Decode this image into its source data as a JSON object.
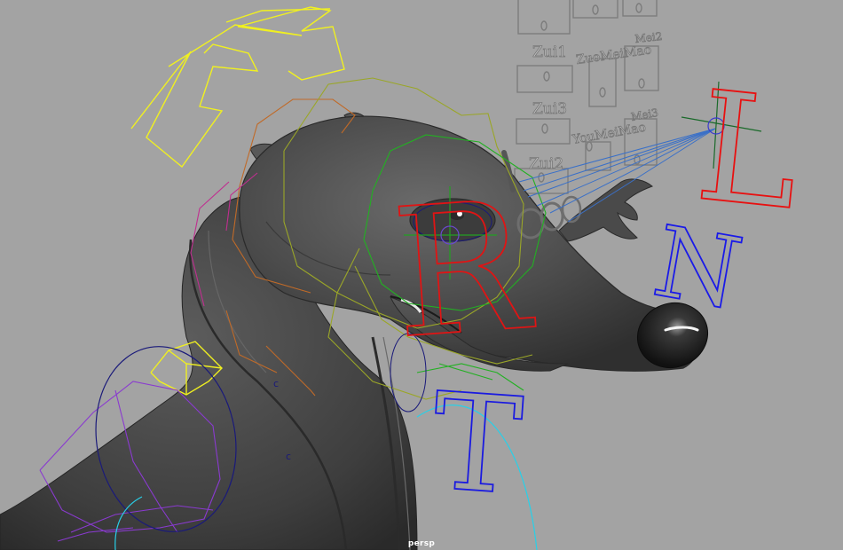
{
  "viewport": {
    "camera_label": "persp",
    "background": "#a3a3a3"
  },
  "face_controls": {
    "labels": {
      "zui1": "Zui1",
      "zuo_mei_mao": "ZuoMeiMao",
      "mei2": "Mei2",
      "zui3": "Zui3",
      "you_mei_mao": "YouMeiMao",
      "mei3": "Mei3",
      "zui2": "Zui2"
    },
    "color": "#7c7c7c"
  },
  "rig_controls": {
    "letters": {
      "r": "R",
      "l": "L",
      "n": "N",
      "t": "T"
    },
    "markers": {
      "c1": "c",
      "c2": "c"
    },
    "colors": {
      "r": "#e01414",
      "l": "#e81010",
      "n": "#1a1ae8",
      "t": "#1a1ae0",
      "yellow": "#f0f020",
      "green": "#22b022",
      "purple": "#8a3ad0",
      "navy": "#1a1a7a",
      "orange": "#c06a28",
      "cyan": "#28d0e8"
    }
  },
  "model": {
    "body_color": "#4a4a4a",
    "nose_color": "#202020"
  }
}
